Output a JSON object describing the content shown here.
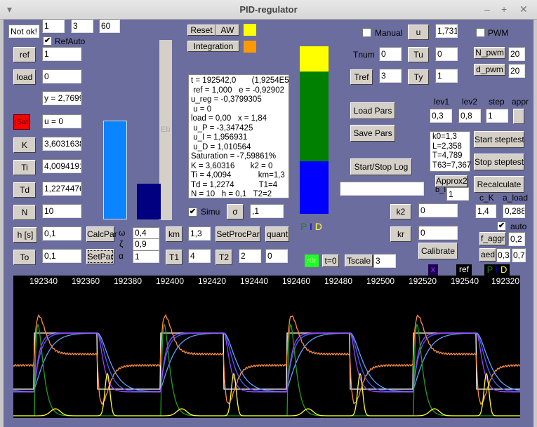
{
  "window": {
    "title": "PID-regulator"
  },
  "left": {
    "status": "Not ok!",
    "top_inputs": [
      "1",
      "3",
      "60"
    ],
    "refauto_label": "RefAuto",
    "refauto_checked": true,
    "ref_label": "ref",
    "ref_value": "1",
    "load_label": "load",
    "load_value": "0",
    "y_readout": "y = 2,7699",
    "sat_label": "(Sat)",
    "u_readout": "u = 0",
    "K_label": "K",
    "K_value": "3,6031638",
    "Ti_label": "Ti",
    "Ti_value": "4,0094191",
    "Td_label": "Td",
    "Td_value": "1,2274476",
    "N_label": "N",
    "N_value": "10",
    "h_label": "h [s]",
    "h_value": "0,1",
    "To_label": "To",
    "To_value": "0,1"
  },
  "bars": {
    "track_label": "Eb",
    "colors": {
      "u_bar": "#0a84ff",
      "y_bar": "#000080"
    }
  },
  "middle": {
    "calcpar": "CalcPar",
    "setpar": "SetPar",
    "omega_sym": "ω",
    "zeta_sym": "ζ",
    "alpha_sym": "α",
    "omega": "0,4",
    "zeta": "0,9",
    "alpha": "1",
    "km_label": "km",
    "km_value": "1,3",
    "setprocpar": "SetProcPar",
    "quant": "quant",
    "T1_label": "T1",
    "T1_value": "4",
    "T2_label": "T2",
    "T2_value": "2",
    "quant_value": "0",
    "simu_label": "Simu",
    "simu_checked": true,
    "sigma_label": "σ",
    "sigma_value": ",1",
    "reset": "Reset",
    "aw": "AW",
    "integration": "Integration",
    "aw_color": "#ffff00",
    "integration_color": "#ff9900"
  },
  "info_lines": [
    "t = 192542,0       (1,9254E5)",
    " ref = 1,000   e = -0,92902",
    "u_reg = -0,3799305",
    " u = 0",
    "load = 0,00   x = 1,84",
    " u_P = -3,347425",
    " u_I = 1,956931",
    " u_D = 1,010564",
    "Saturation = -7,59861%",
    "K = 3,60316       k2 = 0",
    "Ti = 4,0094            km=1,3",
    "Td = 1,2274           T1=4",
    "N = 10   h = 0,1   T2=2"
  ],
  "pid_bar": {
    "colors": [
      "#ffff00",
      "#008000",
      "#0000ff"
    ],
    "legend": [
      "P",
      "I",
      "D"
    ]
  },
  "right": {
    "manual_label": "Manual",
    "manual_checked": false,
    "u_label": "u",
    "u_value": "1,731",
    "pwm_label": "PWM",
    "pwm_checked": false,
    "tnum_label": "Tnum",
    "tnum_value": "0",
    "tu_label": "Tu",
    "tu_value": "0",
    "npwm_label": "N_pwm",
    "npwm_value": "20",
    "tref_label": "Tref",
    "tref_value": "3",
    "ty_label": "Ty",
    "ty_value": "1",
    "dpwm_label": "d_pwm",
    "dpwm_value": "20",
    "lev1_label": "lev1",
    "lev2_label": "lev2",
    "step_label": "step",
    "appr_label": "appr",
    "lev1": "0,3",
    "lev2": "0,8",
    "step": "1",
    "load_pars": "Load Pars",
    "save_pars": "Save Pars",
    "start_stop_log": "Start/Stop Log",
    "log_value": "",
    "results": [
      "k0=1,3",
      "L=2,358",
      "T=4,789",
      "T63=7,367"
    ],
    "start_steptest": "Start steptest",
    "stop_steptest": "Stop steptest",
    "recalculate": "Recalculate",
    "approx2": "Approx2",
    "bI_label": "b_I",
    "bI_value": "1",
    "cK_label": "c_K",
    "aload_label": "a_load",
    "cK": "1,4",
    "aload": "0,288",
    "k2_label": "k2",
    "k2_value": "0",
    "kr_label": "kr",
    "kr_value": "0",
    "calibrate": "Calibrate",
    "auto_label": "auto",
    "auto_checked": true,
    "faggr_label": "f_aggr",
    "faggr_value": "0,2",
    "aed_label": "aed",
    "aed1": "0,3",
    "aed2": "0,7",
    "r0r": "r0r",
    "t0": "t=0",
    "tscale_label": "Tscale",
    "tscale_value": "3"
  },
  "plot": {
    "legend": {
      "x": "x",
      "ref": "ref",
      "P": "P",
      "sep": "I",
      "D": "D"
    },
    "ticks": [
      "192340",
      "192360",
      "192380",
      "192400",
      "192420",
      "192440",
      "192460",
      "192480",
      "192500",
      "192520",
      "192540",
      "192320"
    ],
    "colors": {
      "ref": "#ffffff",
      "u": "#ff8c3c",
      "x": "#a040ff",
      "y": "#4060ff",
      "y2": "#60a0ff",
      "P": "#20a020",
      "D": "#ffff30"
    }
  }
}
